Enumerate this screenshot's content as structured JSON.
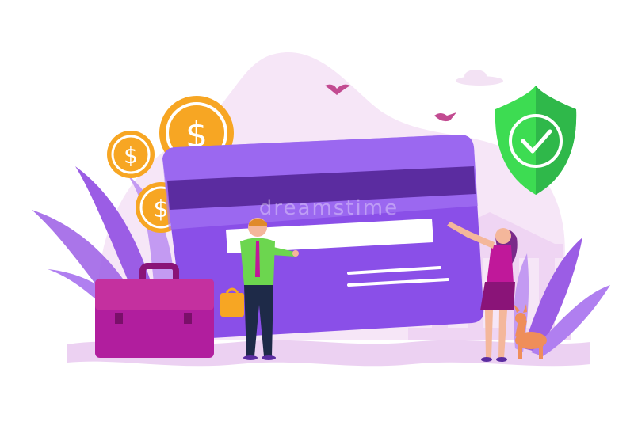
{
  "illustration": {
    "watermark_text": "dreamstime",
    "coin_symbol": "$",
    "icons": [
      "dollar-coin-icon",
      "bank-card-icon",
      "shield-check-icon",
      "briefcase-icon",
      "bank-building-icon",
      "bird-icon",
      "deer-icon",
      "leaf-icon"
    ]
  },
  "colors": {
    "card_light": "#a67af5",
    "card_dark": "#8a4fe8",
    "card_stripe": "#5b2ca0",
    "card_panel": "#ffffff",
    "coin_fill": "#f7a623",
    "coin_ring": "#ffffff",
    "shield": "#3ddc52",
    "shield_dark": "#2fb84a",
    "briefcase": "#b11e9e",
    "leaves": "#9b5de5",
    "blob": "#f6e6f7",
    "ground": "#ecd1f2",
    "bank": "#efd5f3",
    "shirt_man": "#6cd64f",
    "woman_dress": "#c0189a",
    "skin": "#f4b79b",
    "deer": "#ef8e5a",
    "bird": "#c24b91"
  }
}
